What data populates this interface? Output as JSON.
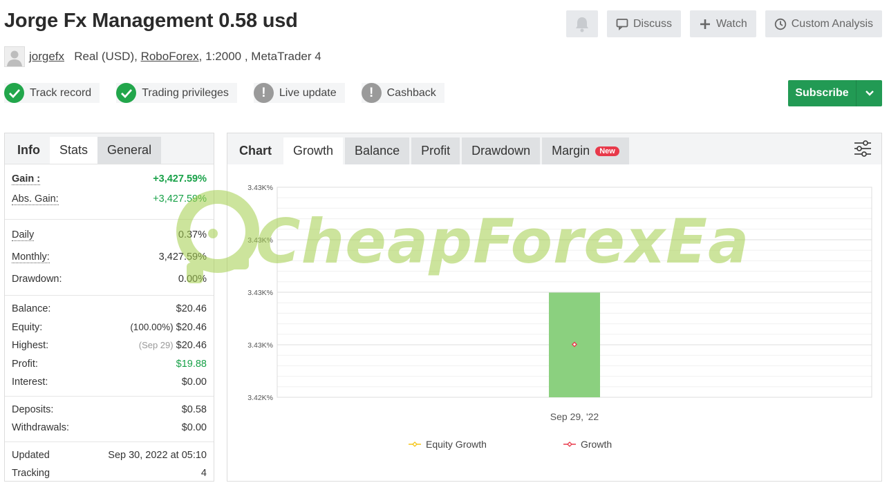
{
  "header": {
    "title": "Jorge Fx Management 0.58 usd",
    "discuss_label": "Discuss",
    "watch_label": "Watch",
    "custom_analysis_label": "Custom Analysis"
  },
  "owner": {
    "username": "jorgefx",
    "account_type": "Real (USD),",
    "broker": "RoboForex",
    "details": ", 1:2000 , MetaTrader 4"
  },
  "badges": [
    {
      "label": "Track record",
      "status": "verified"
    },
    {
      "label": "Trading privileges",
      "status": "verified"
    },
    {
      "label": "Live update",
      "status": "warning"
    },
    {
      "label": "Cashback",
      "status": "warning"
    }
  ],
  "subscribe_label": "Subscribe",
  "left_tabs": {
    "info": "Info",
    "stats": "Stats",
    "general": "General"
  },
  "stats": {
    "gain_label": "Gain :",
    "gain_value": "+3,427.59%",
    "abs_gain_label": "Abs. Gain:",
    "abs_gain_value": "+3,427.59%",
    "daily_label": "Daily",
    "daily_value": "0.37%",
    "monthly_label": "Monthly:",
    "monthly_value": "3,427.59%",
    "drawdown_label": "Drawdown:",
    "drawdown_value": "0.00%",
    "balance_label": "Balance:",
    "balance_value": "$20.46",
    "equity_label": "Equity:",
    "equity_pct": "(100.00%)",
    "equity_value": "$20.46",
    "highest_label": "Highest:",
    "highest_date": "(Sep 29)",
    "highest_value": "$20.46",
    "profit_label": "Profit:",
    "profit_value": "$19.88",
    "interest_label": "Interest:",
    "interest_value": "$0.00",
    "deposits_label": "Deposits:",
    "deposits_value": "$0.58",
    "withdrawals_label": "Withdrawals:",
    "withdrawals_value": "$0.00",
    "updated_label": "Updated",
    "updated_value": "Sep 30, 2022 at 05:10",
    "tracking_label": "Tracking",
    "tracking_value": "4"
  },
  "right_tabs": {
    "chart": "Chart",
    "growth": "Growth",
    "balance": "Balance",
    "profit": "Profit",
    "drawdown": "Drawdown",
    "margin": "Margin",
    "new_badge": "New"
  },
  "watermark": "CheapForexEa",
  "colors": {
    "accent_green": "#229a54",
    "bar_green": "#8bd07f",
    "growth_red": "#e8394a",
    "equity_yellow": "#f5c518"
  },
  "chart_data": {
    "type": "bar",
    "categories": [
      "Sep 29, '22"
    ],
    "series": [
      {
        "name": "Growth",
        "values": [
          3427.59
        ]
      },
      {
        "name": "Equity Growth",
        "values": []
      }
    ],
    "y_tick_labels": [
      "3.43K%",
      "3.43K%",
      "3.43K%",
      "3.43K%",
      "3.42K%"
    ],
    "ylim": [
      3424.6,
      3430.6
    ],
    "marker_value": 3427.59,
    "legend": [
      "Equity Growth",
      "Growth"
    ],
    "legend_position": "bottom",
    "grid": true
  }
}
